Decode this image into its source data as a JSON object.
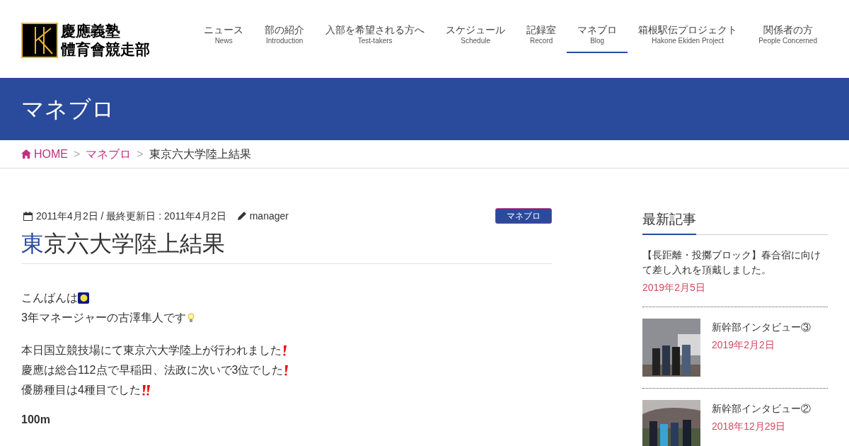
{
  "logo": {
    "line1": "慶應義塾",
    "line2": "體育會競走部"
  },
  "nav": [
    {
      "ja": "ニュース",
      "en": "News",
      "selected": false
    },
    {
      "ja": "部の紹介",
      "en": "Introduction",
      "selected": false
    },
    {
      "ja": "入部を希望される方へ",
      "en": "Test-takers",
      "selected": false
    },
    {
      "ja": "スケジュール",
      "en": "Schedule",
      "selected": false
    },
    {
      "ja": "記録室",
      "en": "Record",
      "selected": false
    },
    {
      "ja": "マネブロ",
      "en": "Blog",
      "selected": true
    },
    {
      "ja": "箱根駅伝プロジェクト",
      "en": "Hakone Ekiden Project",
      "selected": false
    },
    {
      "ja": "関係者の方",
      "en": "People Concerned",
      "selected": false
    }
  ],
  "page_title": "マネブロ",
  "breadcrumb": [
    {
      "label": "HOME",
      "kind": "home"
    },
    {
      "separator": ">",
      "label": "マネブロ",
      "kind": "link"
    },
    {
      "separator": ">",
      "label": "東京六大学陸上結果",
      "kind": "current"
    }
  ],
  "post": {
    "date": "2011年4月2日 / 最終更新日 : 2011年4月2日",
    "author": "manager",
    "category": "マネブロ",
    "title_accent": "東",
    "title_rest": "京六大学陸上結果",
    "paragraphs": [
      [
        {
          "text": "こんばんは",
          "kind": "moon"
        },
        {
          "text": "3年マネージャーの古澤隼人です",
          "kind": "bulb"
        }
      ],
      [
        {
          "text": "本日国立競技場にて東京六大学陸上が行われました",
          "kind": "exclaim"
        },
        {
          "text": "慶應は総合112点で早稲田、法政に次いで3位でした",
          "kind": "exclaim"
        },
        {
          "text": "優勝種目は4種目でした",
          "kind": "double"
        }
      ]
    ],
    "subheading": "100m"
  },
  "sidebar": {
    "heading": "最新記事",
    "items": [
      {
        "title": "【長距離・投擲ブロック】春合宿に向けて差し入れを頂戴しました。",
        "date": "2019年2月5日"
      },
      {
        "title": "新幹部インタビュー③",
        "date": "2019年2月2日",
        "kind": "picture"
      },
      {
        "title": "新幹部インタビュー②",
        "date": "2018年12月29日",
        "kind": "picture"
      }
    ]
  }
}
